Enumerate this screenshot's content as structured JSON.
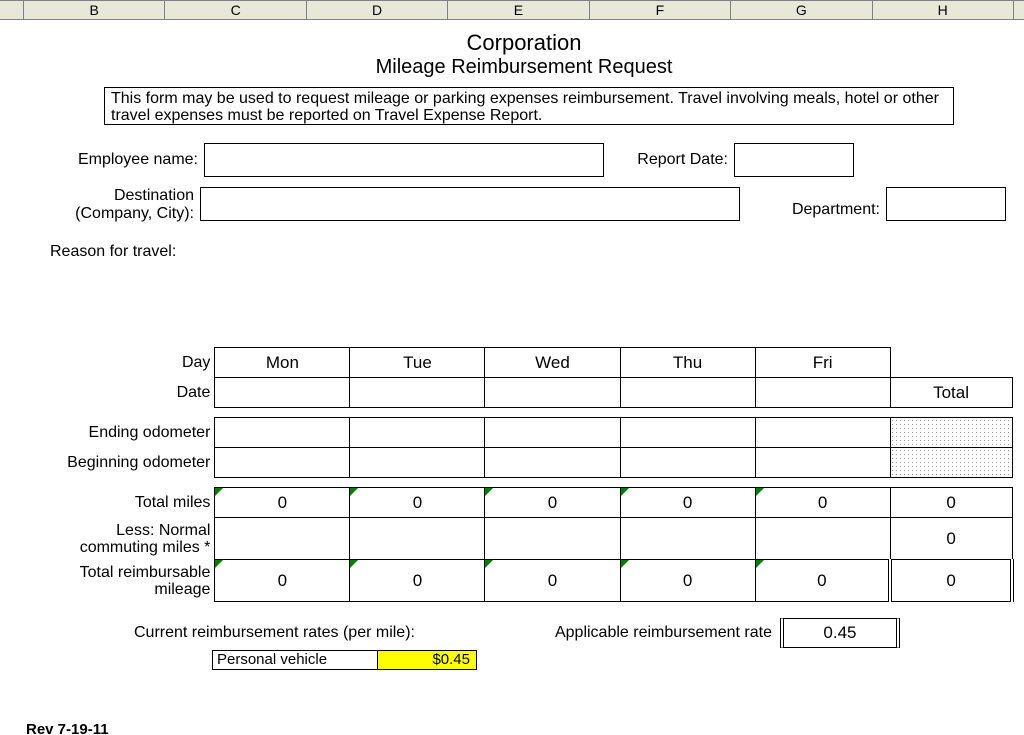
{
  "columns": [
    "B",
    "C",
    "D",
    "E",
    "F",
    "G",
    "H"
  ],
  "title1": "Corporation",
  "title2": "Mileage Reimbursement Request",
  "instructions": "This form may be used to request mileage or parking expenses reimbursement.  Travel involving meals, hotel or other travel expenses must be reported on Travel Expense Report.",
  "labels": {
    "employee_name": "Employee name:",
    "report_date": "Report Date:",
    "destination_line1": "Destination",
    "destination_line2": "(Company, City):",
    "department": "Department:",
    "reason": "Reason for travel:",
    "day": "Day",
    "date": "Date",
    "total": "Total",
    "ending_odo": "Ending odometer",
    "beginning_odo": "Beginning odometer",
    "total_miles": "Total miles",
    "less_commute_line1": "Less: Normal",
    "less_commute_line2": "commuting miles *",
    "reimbursable_line1": "Total reimbursable",
    "reimbursable_line2": "mileage",
    "current_rates": "Current reimbursement rates (per mile):",
    "applicable_rate": "Applicable reimbursement rate",
    "personal_vehicle": "Personal vehicle"
  },
  "days": [
    "Mon",
    "Tue",
    "Wed",
    "Thu",
    "Fri"
  ],
  "dates": [
    "",
    "",
    "",
    "",
    ""
  ],
  "ending_odometer": [
    "",
    "",
    "",
    "",
    ""
  ],
  "beginning_odometer": [
    "",
    "",
    "",
    "",
    ""
  ],
  "total_miles": [
    "0",
    "0",
    "0",
    "0",
    "0"
  ],
  "total_miles_total": "0",
  "commuting_miles": [
    "",
    "",
    "",
    "",
    ""
  ],
  "commuting_miles_total": "0",
  "reimbursable_miles": [
    "0",
    "0",
    "0",
    "0",
    "0"
  ],
  "reimbursable_total": "0",
  "applicable_rate_value": "0.45",
  "personal_vehicle_rate": "$0.45",
  "rev_footer": "Rev 7-19-11"
}
